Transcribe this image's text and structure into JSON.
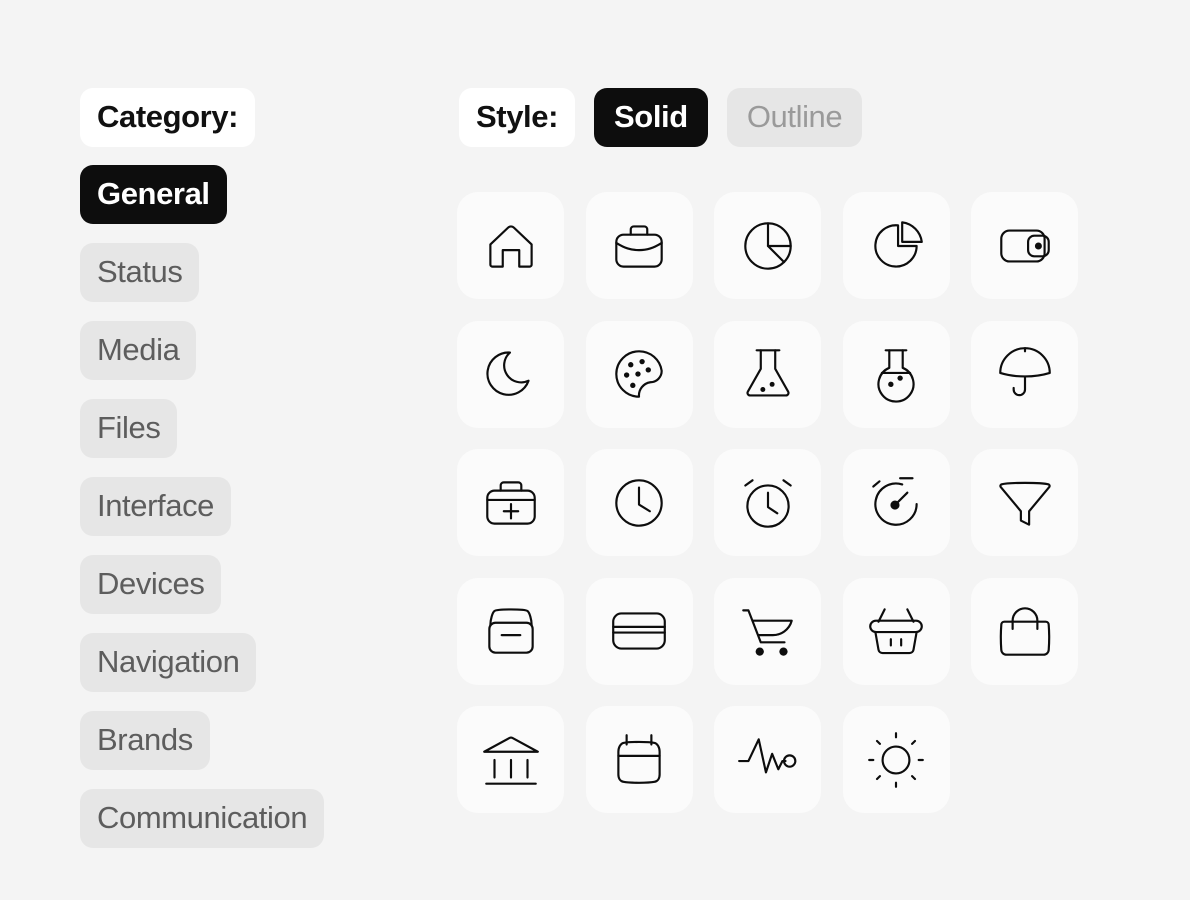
{
  "background_color": "#f4f4f4",
  "accent_color": "#0d0d0d",
  "sidebar": {
    "heading": "Category:",
    "items": [
      {
        "label": "General",
        "state": "active"
      },
      {
        "label": "Status",
        "state": "idle"
      },
      {
        "label": "Media",
        "state": "idle"
      },
      {
        "label": "Files",
        "state": "idle"
      },
      {
        "label": "Interface",
        "state": "idle"
      },
      {
        "label": "Devices",
        "state": "idle"
      },
      {
        "label": "Navigation",
        "state": "idle"
      },
      {
        "label": "Brands",
        "state": "idle"
      },
      {
        "label": "Communication",
        "state": "idle"
      }
    ]
  },
  "style_toggle": {
    "label": "Style:",
    "options": [
      {
        "label": "Solid",
        "state": "selected"
      },
      {
        "label": "Outline",
        "state": "unselected"
      }
    ],
    "selected": "Solid"
  },
  "icon_grid": {
    "columns": 5,
    "rows": 5,
    "count": 24,
    "icons": [
      {
        "name": "home-icon",
        "label": "Home"
      },
      {
        "name": "briefcase-icon",
        "label": "Briefcase"
      },
      {
        "name": "pie-chart-icon",
        "label": "Pie chart"
      },
      {
        "name": "pie-chart-slice-icon",
        "label": "Pie chart slice"
      },
      {
        "name": "wallet-icon",
        "label": "Wallet"
      },
      {
        "name": "moon-icon",
        "label": "Moon"
      },
      {
        "name": "cookie-icon",
        "label": "Cookie"
      },
      {
        "name": "flask-icon",
        "label": "Flask"
      },
      {
        "name": "round-flask-icon",
        "label": "Round flask"
      },
      {
        "name": "umbrella-icon",
        "label": "Umbrella"
      },
      {
        "name": "first-aid-kit-icon",
        "label": "First aid kit"
      },
      {
        "name": "clock-icon",
        "label": "Clock"
      },
      {
        "name": "alarm-clock-icon",
        "label": "Alarm clock"
      },
      {
        "name": "stopwatch-icon",
        "label": "Stopwatch"
      },
      {
        "name": "funnel-icon",
        "label": "Funnel"
      },
      {
        "name": "box-icon",
        "label": "Box"
      },
      {
        "name": "credit-card-icon",
        "label": "Credit card"
      },
      {
        "name": "shopping-cart-icon",
        "label": "Shopping cart"
      },
      {
        "name": "shopping-basket-icon",
        "label": "Shopping basket"
      },
      {
        "name": "shopping-bag-icon",
        "label": "Shopping bag"
      },
      {
        "name": "bank-icon",
        "label": "Bank"
      },
      {
        "name": "calendar-icon",
        "label": "Calendar"
      },
      {
        "name": "pulse-icon",
        "label": "Pulse"
      },
      {
        "name": "sun-icon",
        "label": "Sun"
      }
    ]
  }
}
